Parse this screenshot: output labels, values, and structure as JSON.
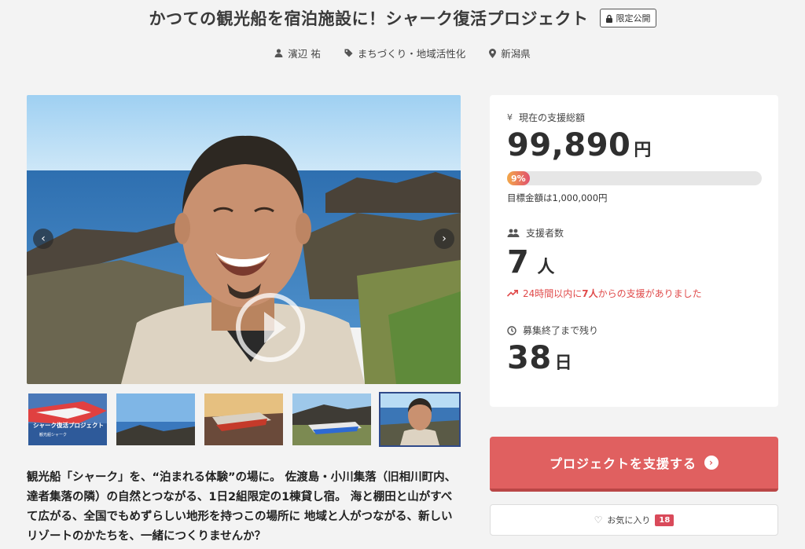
{
  "header": {
    "title": "かつての観光船を宿泊施設に！シャーク復活プロジェクト",
    "private_badge": "限定公開",
    "owner": "濱辺 祐",
    "category": "まちづくり・地域活性化",
    "location": "新潟県"
  },
  "media": {
    "thumbnail_caption": "シャーク復活プロジェクト",
    "thumbnail_subcaption": "観光船シャーク"
  },
  "intro": {
    "lines": [
      "観光船「シャーク」を、“泊まれる体験”の場に。 佐渡島・小川集落（旧相川町内、",
      "達者集落の隣）の自然とつながる、1日2組限定の1棟貸し宿。 海と棚田と山がすべ",
      "て広がる、全国でもめずらしい地形を持つこの場所に 地域と人がつながる、新しい",
      "リゾートのかたちを、一緒につくりませんか？"
    ]
  },
  "stats": {
    "funding_label": "現在の支援総額",
    "funding_amount": "99,890",
    "funding_unit": "円",
    "progress_percent": 9,
    "progress_label": "9%",
    "goal_text": "目標金額は1,000,000円",
    "supporters_label": "支援者数",
    "supporters_count": "7",
    "supporters_unit": "人",
    "trend_prefix": "24時間以内に",
    "trend_count": "7人",
    "trend_suffix": "からの支援がありました",
    "remaining_label": "募集終了まで残り",
    "remaining_days": "38",
    "remaining_unit": "日"
  },
  "actions": {
    "support_label": "プロジェクトを支援する",
    "favorite_label": "お気に入り",
    "favorite_count": "18"
  },
  "colors": {
    "accent": "#e06060",
    "trend": "#e04a4a",
    "progress_start": "#f3a94a",
    "progress_end": "#e0506d"
  }
}
